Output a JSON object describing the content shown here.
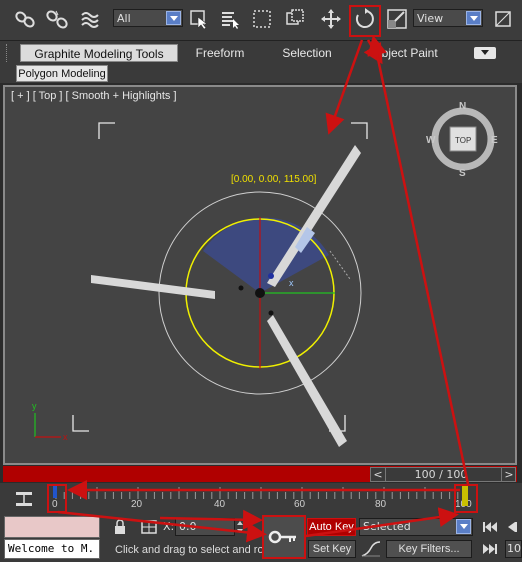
{
  "toolbar": {
    "selection_filter": "All",
    "reference_coord": "View",
    "icons": [
      "link-icon",
      "unlink-icon",
      "bind-spacewarp-icon",
      "select-object-icon",
      "select-by-name-icon",
      "rectangle-selection-icon",
      "window-crossing-icon",
      "move-icon",
      "rotate-icon",
      "scale-icon",
      "pivot-icon"
    ]
  },
  "ribbon": {
    "tabs": [
      "Graphite Modeling Tools",
      "Freeform",
      "Selection",
      "Object Paint"
    ],
    "panel_tab": "Polygon Modeling"
  },
  "viewport": {
    "label": "[ + ] [ Top ] [ Smooth + Highlights ]",
    "coordinate_readout": "[0.00, 0.00, 115.00]",
    "viewcube_face": "TOP",
    "compass": {
      "n": "N",
      "s": "S",
      "e": "E",
      "w": "W"
    },
    "axis_x": "x",
    "axis_y": "y"
  },
  "timeline": {
    "frame_display": "100 / 100",
    "ticks": [
      "0",
      "20",
      "40",
      "60",
      "80",
      "100"
    ],
    "prev_arrow": "<",
    "next_arrow": ">"
  },
  "status": {
    "listener": "Welcome to M.",
    "prompt": "Click and drag to select and ro",
    "x_label": "X:",
    "x_value": "0.0",
    "auto_key": "Auto Key",
    "key_mode": "Selected",
    "set_key": "Set Key",
    "key_filters": "Key Filters...",
    "frame_field": "10"
  },
  "colors": {
    "highlight_red": "#cc1111",
    "autokey_red": "#b00000",
    "gizmo_yellow": "#f0f000"
  }
}
